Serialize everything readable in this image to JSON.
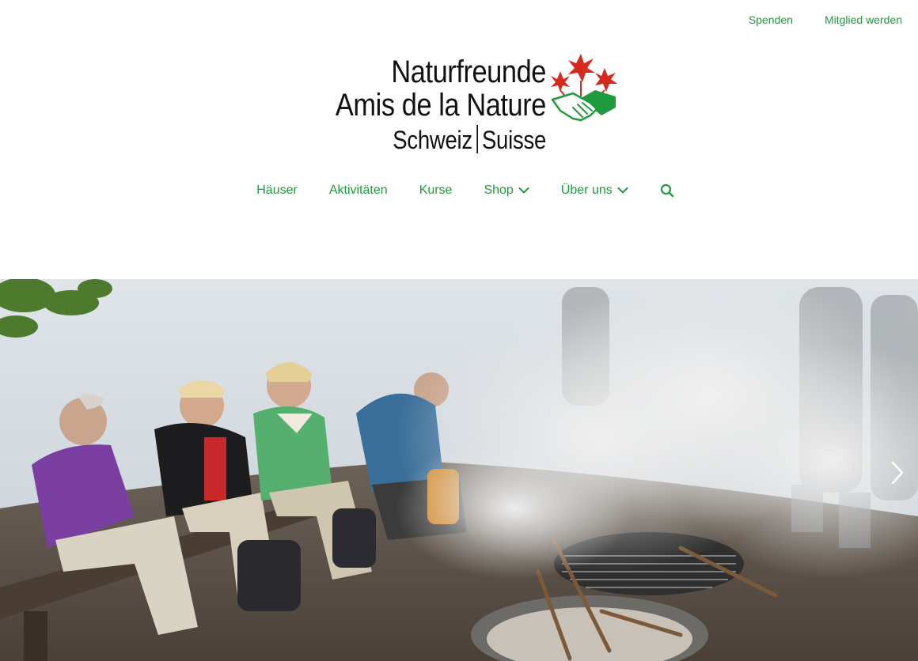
{
  "top_links": {
    "donate": "Spenden",
    "become_member": "Mitglied werden"
  },
  "logo": {
    "line1": "Naturfreunde",
    "line2": "Amis de la Nature",
    "line3_left": "Schweiz",
    "line3_right": "Suisse"
  },
  "nav": {
    "items": [
      {
        "label": "Häuser",
        "has_dropdown": false
      },
      {
        "label": "Aktivitäten",
        "has_dropdown": false
      },
      {
        "label": "Kurse",
        "has_dropdown": false
      },
      {
        "label": "Shop",
        "has_dropdown": true
      },
      {
        "label": "Über uns",
        "has_dropdown": true
      }
    ],
    "search_icon": "search-icon"
  },
  "hero": {
    "next_icon": "chevron-right-icon"
  },
  "colors": {
    "brand_green": "#1f9a3d",
    "logo_red": "#d52b1e",
    "text_dark": "#111111"
  }
}
